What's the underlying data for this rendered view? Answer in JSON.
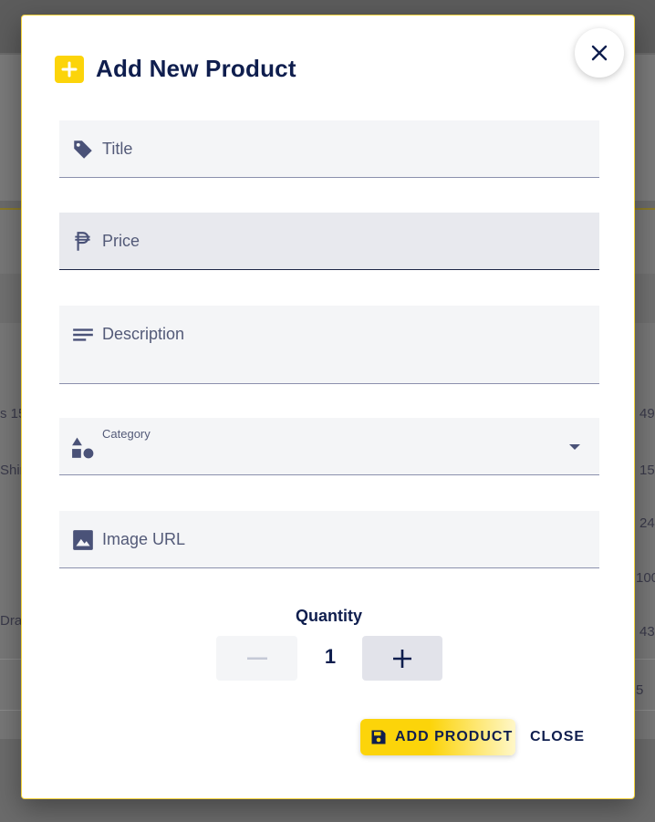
{
  "background": {
    "left_fragments": [
      "s 15",
      "Shir",
      "Dra"
    ],
    "right_fragments": [
      "49",
      "15",
      "24",
      "100",
      "43",
      "5"
    ]
  },
  "dialog": {
    "title": "Add New Product",
    "title_icon": "plus-icon",
    "close_icon": "close-icon"
  },
  "fields": {
    "title": {
      "placeholder": "Title",
      "icon": "tag-icon"
    },
    "price": {
      "placeholder": "Price",
      "icon": "peso-icon"
    },
    "description": {
      "placeholder": "Description",
      "icon": "notes-icon"
    },
    "category": {
      "label": "Category",
      "value": "",
      "icon": "shapes-icon"
    },
    "image_url": {
      "placeholder": "Image URL",
      "icon": "image-icon"
    }
  },
  "quantity": {
    "label": "Quantity",
    "value": "1"
  },
  "actions": {
    "add_label": "ADD PRODUCT",
    "close_label": "CLOSE"
  },
  "colors": {
    "accent": "#fcd40a",
    "text_primary": "#0f1e4e",
    "field_bg": "#f4f5f7"
  }
}
